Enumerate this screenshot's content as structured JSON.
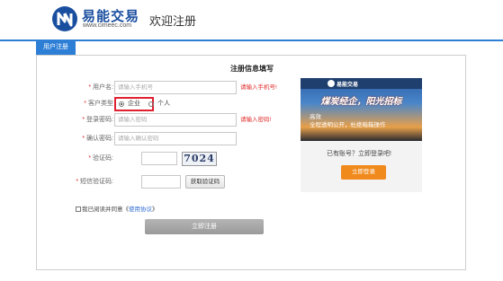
{
  "header": {
    "brand": "易能交易",
    "brand_url": "www.cimeec.com",
    "title": "欢迎注册"
  },
  "tab": {
    "label": "用户注册"
  },
  "form": {
    "title": "注册信息填写",
    "username": {
      "label": "用户名:",
      "placeholder": "请输入手机号",
      "error": "请输入手机号!"
    },
    "user_type": {
      "label": "客户类型",
      "options": [
        "企业",
        "个人"
      ],
      "selected": "企业"
    },
    "password": {
      "label": "登录密码:",
      "placeholder": "请输入密码",
      "error": "请输入密码!"
    },
    "confirm": {
      "label": "确认密码:",
      "placeholder": "请输入确认密码"
    },
    "captcha": {
      "label": "验证码:",
      "value": "7024"
    },
    "sms": {
      "label": "短信验证码:",
      "button": "获取验证码"
    },
    "agree": {
      "text": "我已阅读并同意《",
      "link": "使用协议",
      "suffix": "》"
    },
    "submit": "立即注册"
  },
  "banner": {
    "brand": "易能交易",
    "headline": "煤炭经企，阳光招标",
    "line1": "高效",
    "line2": "全程透明公开，杜绝暗箱操作"
  },
  "side": {
    "question": "已有账号？立即登录吧!",
    "login_button": "立即登录"
  },
  "colors": {
    "accent": "#2d7fd6",
    "error": "#e02a2a",
    "highlight": "#e02030",
    "login": "#f08a1c"
  }
}
